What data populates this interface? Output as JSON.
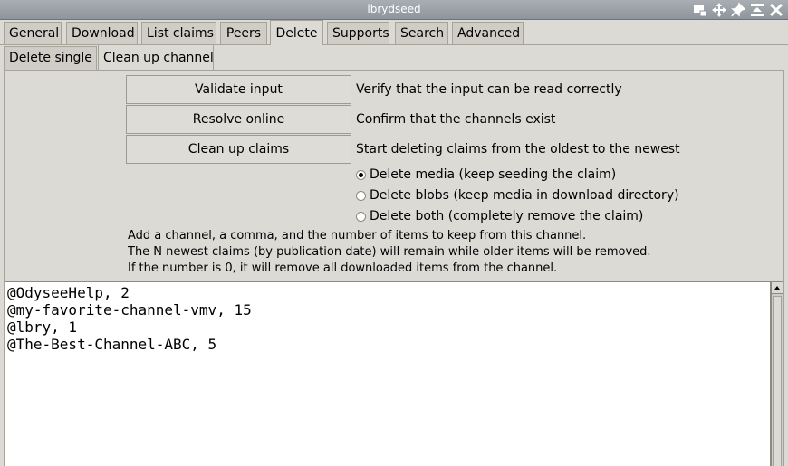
{
  "window": {
    "title": "lbrydseed"
  },
  "main_tabs": [
    "General",
    "Download",
    "List claims",
    "Peers",
    "Delete",
    "Supports",
    "Search",
    "Advanced"
  ],
  "active_main_tab": "Delete",
  "sub_tabs": [
    "Delete single",
    "Clean up channel"
  ],
  "active_sub_tab": "Clean up channel",
  "actions": [
    {
      "label": "Validate input",
      "description": "Verify that the input can be read correctly"
    },
    {
      "label": "Resolve online",
      "description": "Confirm that the channels exist"
    },
    {
      "label": "Clean up claims",
      "description": "Start deleting claims from the oldest to the newest"
    }
  ],
  "delete_options": [
    {
      "label": "Delete media (keep seeding the claim)",
      "checked": true
    },
    {
      "label": "Delete blobs (keep media in download directory)",
      "checked": false
    },
    {
      "label": "Delete both (completely remove the claim)",
      "checked": false
    }
  ],
  "help_lines": [
    "Add a channel, a comma, and the number of items to keep from this channel.",
    "The N newest claims (by publication date) will remain while older items will be removed.",
    "If the number is 0, it will remove all downloaded items from the channel."
  ],
  "channel_input": "@OdyseeHelp, 2\n@my-favorite-channel-vmv, 15\n@lbry, 1\n@The-Best-Channel-ABC, 5"
}
